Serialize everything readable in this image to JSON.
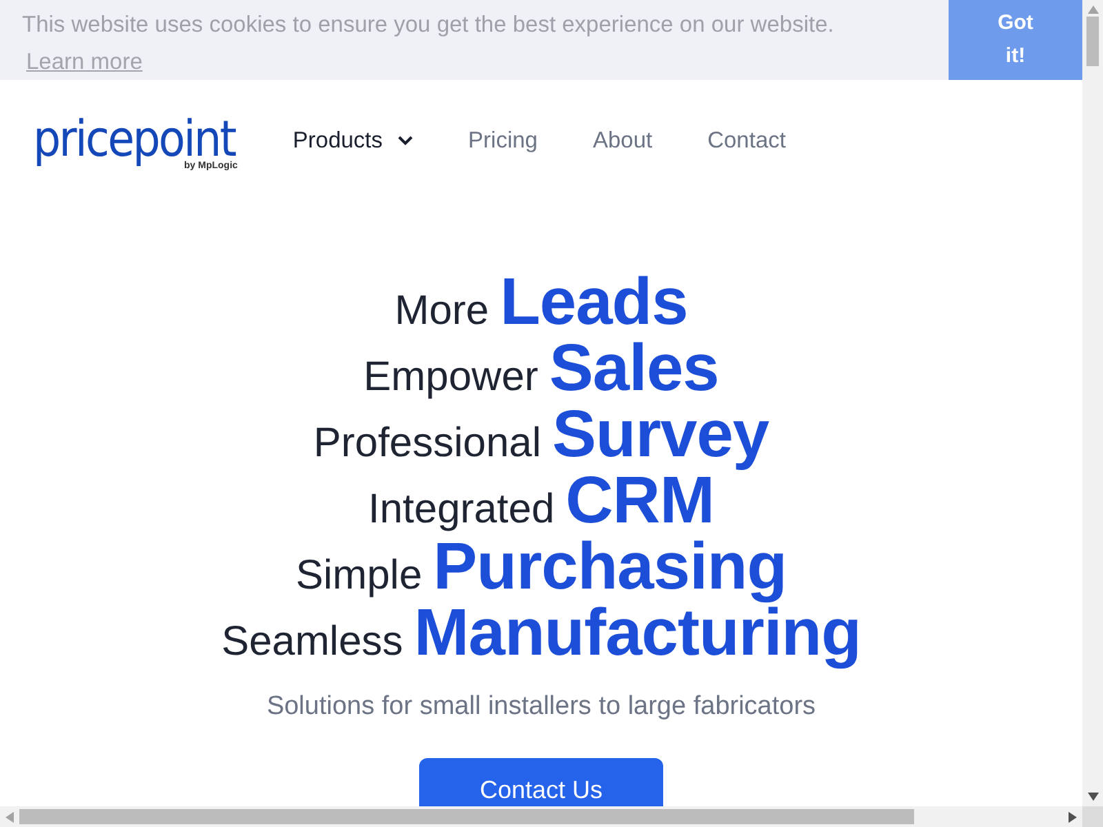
{
  "cookie_banner": {
    "message": "This website uses cookies to ensure you get the best experience on our website.",
    "link": "Learn more",
    "button": "Got it!"
  },
  "logo": {
    "name": "pricepoint",
    "byline": "by MpLogic"
  },
  "nav": [
    {
      "label": "Products",
      "dropdown": true,
      "selected": true
    },
    {
      "label": "Pricing",
      "dropdown": false,
      "selected": false
    },
    {
      "label": "About",
      "dropdown": false,
      "selected": false
    },
    {
      "label": "Contact",
      "dropdown": false,
      "selected": false
    }
  ],
  "hero": {
    "lines": [
      {
        "light": "More",
        "bold": "Leads"
      },
      {
        "light": "Empower",
        "bold": "Sales"
      },
      {
        "light": "Professional",
        "bold": "Survey"
      },
      {
        "light": "Integrated",
        "bold": "CRM"
      },
      {
        "light": "Simple",
        "bold": "Purchasing"
      },
      {
        "light": "Seamless",
        "bold": "Manufacturing"
      }
    ],
    "subtitle": "Solutions for small installers to large fabricators",
    "button": "Contact Us"
  }
}
